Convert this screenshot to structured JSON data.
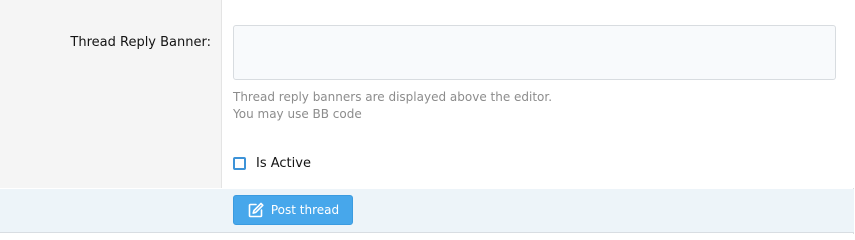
{
  "form": {
    "thread_reply_banner": {
      "label": "Thread Reply Banner:",
      "value": "",
      "hint_line_1": "Thread reply banners are displayed above the editor.",
      "hint_line_2": "You may use BB code"
    },
    "is_active": {
      "label": "Is Active",
      "checked": false
    },
    "submit": {
      "label": "Post thread",
      "icon": "edit-icon"
    }
  },
  "colors": {
    "accent": "#47a7eb",
    "label_column_bg": "#f5f5f5",
    "submit_row_bg": "#edf4f9",
    "hint_text": "#8c8c8c",
    "checkbox_border": "#3d93d8"
  }
}
